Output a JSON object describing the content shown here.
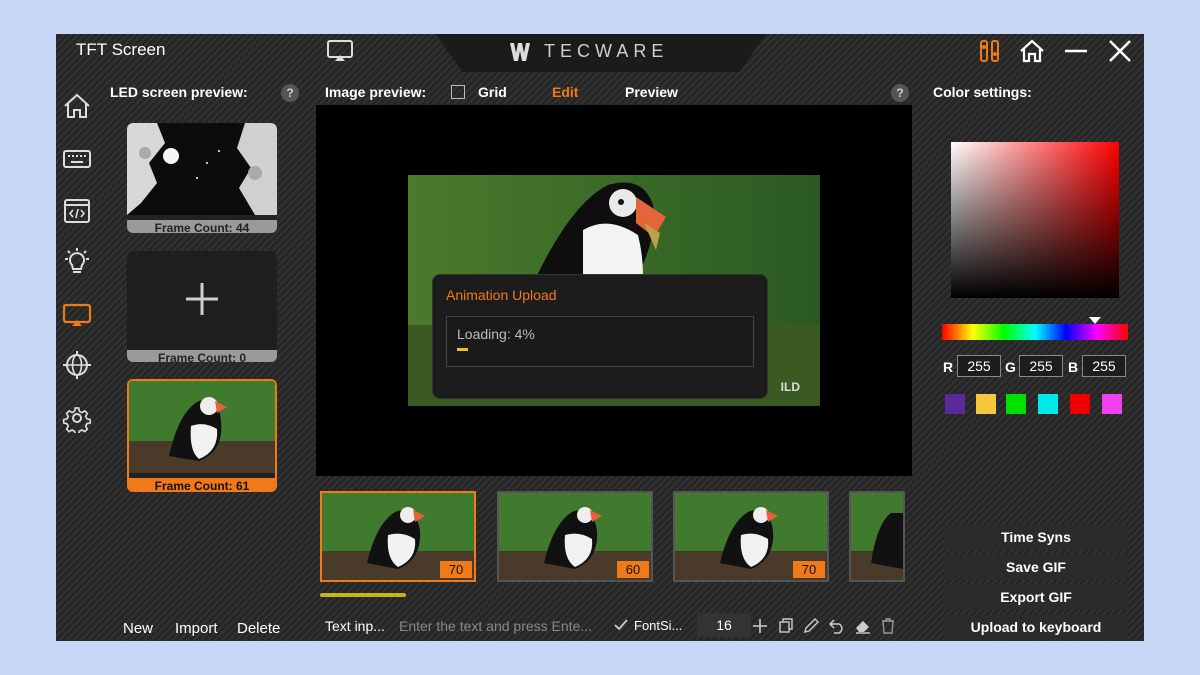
{
  "app": {
    "title": "TFT Screen",
    "brand": "TECWARE"
  },
  "sidebar": {
    "items": [
      {
        "name": "home",
        "icon": "home-icon"
      },
      {
        "name": "keyboard",
        "icon": "keyboard-icon"
      },
      {
        "name": "macro",
        "icon": "code-window-icon"
      },
      {
        "name": "lighting",
        "icon": "lightbulb-icon"
      },
      {
        "name": "tft-screen",
        "icon": "screen-cast-icon",
        "active": true
      },
      {
        "name": "network",
        "icon": "globe-icon"
      },
      {
        "name": "settings",
        "icon": "gear-icon"
      }
    ]
  },
  "led_preview": {
    "label": "LED screen preview:",
    "help": "?",
    "cards": [
      {
        "frame_count": "Frame Count: 44"
      },
      {
        "frame_count": "Frame Count: 0"
      },
      {
        "frame_count": "Frame Count: 61",
        "active": true
      }
    ],
    "actions": {
      "new": "New",
      "import": "Import",
      "delete": "Delete"
    }
  },
  "image_preview": {
    "label": "Image preview:",
    "grid_label": "Grid",
    "edit_label": "Edit",
    "preview_label": "Preview",
    "help": "?",
    "watermark": "ILD"
  },
  "upload_dialog": {
    "title": "Animation Upload",
    "loading_text": "Loading: 4%",
    "progress": 0.04
  },
  "thumbnails": [
    {
      "badge": "70",
      "active": true
    },
    {
      "badge": "60"
    },
    {
      "badge": "70"
    },
    {
      "badge": ""
    }
  ],
  "text_toolbar": {
    "label": "Text inp...",
    "placeholder": "Enter the text and press Ente...",
    "font_label": "FontSi...",
    "font_size": "16"
  },
  "color_settings": {
    "label": "Color settings:",
    "r_label": "R",
    "g_label": "G",
    "b_label": "B",
    "r": "255",
    "g": "255",
    "b": "255",
    "swatches": [
      "#5b2a9a",
      "#f5c73a",
      "#00e000",
      "#00e8e8",
      "#ee0000",
      "#f040f0"
    ]
  },
  "actions": {
    "time_sync": "Time Syns",
    "save_gif": "Save GIF",
    "export_gif": "Export GIF",
    "upload": "Upload to keyboard"
  },
  "colors": {
    "accent": "#f07a1a"
  }
}
